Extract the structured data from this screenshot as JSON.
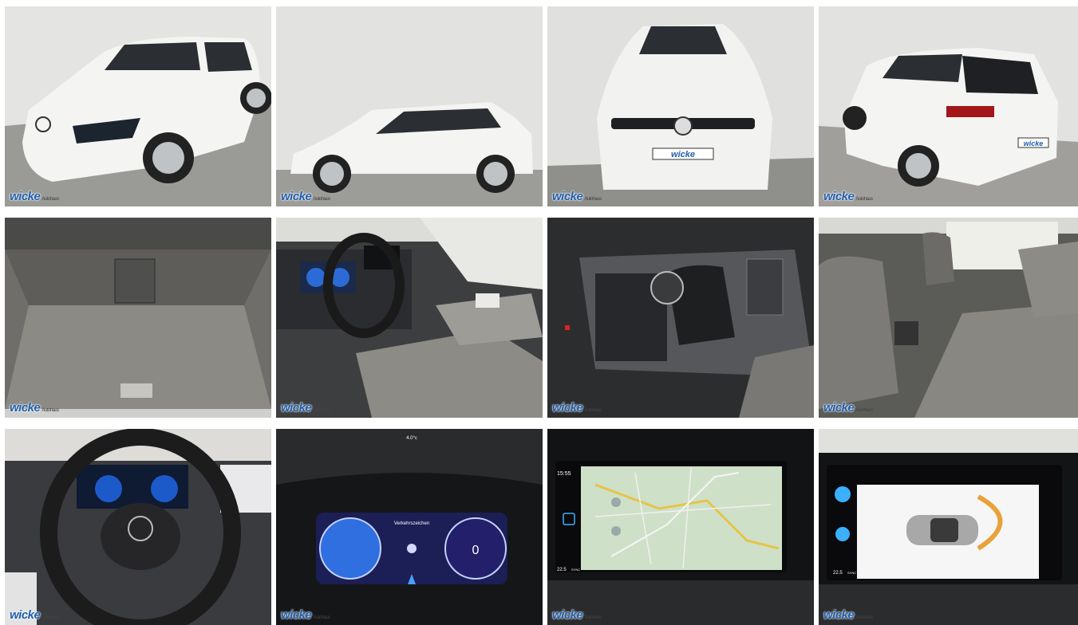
{
  "gallery": {
    "watermark": "wicke",
    "watermark_tag": "Autohaus",
    "photos": [
      {
        "subject": "front-three-quarter"
      },
      {
        "subject": "side-profile"
      },
      {
        "subject": "front-view",
        "plate": "wicke"
      },
      {
        "subject": "rear-three-quarter",
        "plate": "wicke"
      },
      {
        "subject": "trunk"
      },
      {
        "subject": "driver-cockpit"
      },
      {
        "subject": "gear-shifter"
      },
      {
        "subject": "rear-seats"
      },
      {
        "subject": "steering-wheel"
      },
      {
        "subject": "instrument-cluster",
        "speed": "0",
        "header": "Verkehrszeichen",
        "temp": "4.0°c"
      },
      {
        "subject": "navigation-screen",
        "time": "15:55",
        "temp": "22.5",
        "sync": "SYNC"
      },
      {
        "subject": "parking-sensor-screen",
        "temp": "22.5",
        "sync": "SYNC"
      }
    ]
  },
  "colors": {
    "brand": "#1f5fae",
    "car": "#f4f4f2",
    "floor": "#9c9c98",
    "wall": "#dcdcda"
  }
}
